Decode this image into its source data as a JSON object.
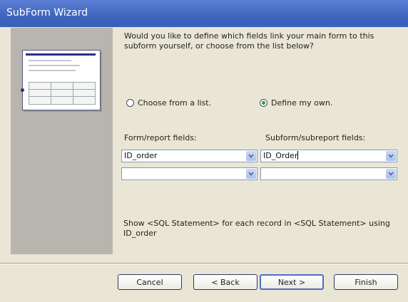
{
  "window": {
    "title": "SubForm Wizard"
  },
  "question": "Would you like to define which fields link your main form to this subform yourself, or choose from the list below?",
  "options": [
    {
      "label": "Choose from a list.",
      "checked": false
    },
    {
      "label": "Define my own.",
      "checked": true
    }
  ],
  "form_fields": {
    "label": "Form/report fields:",
    "combos": [
      {
        "value": "ID_order"
      },
      {
        "value": ""
      }
    ]
  },
  "subform_fields": {
    "label": "Subform/subreport fields:",
    "combos": [
      {
        "value": "ID_Order"
      },
      {
        "value": ""
      }
    ]
  },
  "description": "Show <SQL Statement> for each record in <SQL Statement> using ID_order",
  "buttons": {
    "cancel": "Cancel",
    "back": "< Back",
    "next": "Next >",
    "finish": "Finish"
  },
  "colors": {
    "titlebar": "#3f65bf",
    "dialog_bg": "#eae6d6",
    "selected_radio": "#2e9a3a"
  }
}
